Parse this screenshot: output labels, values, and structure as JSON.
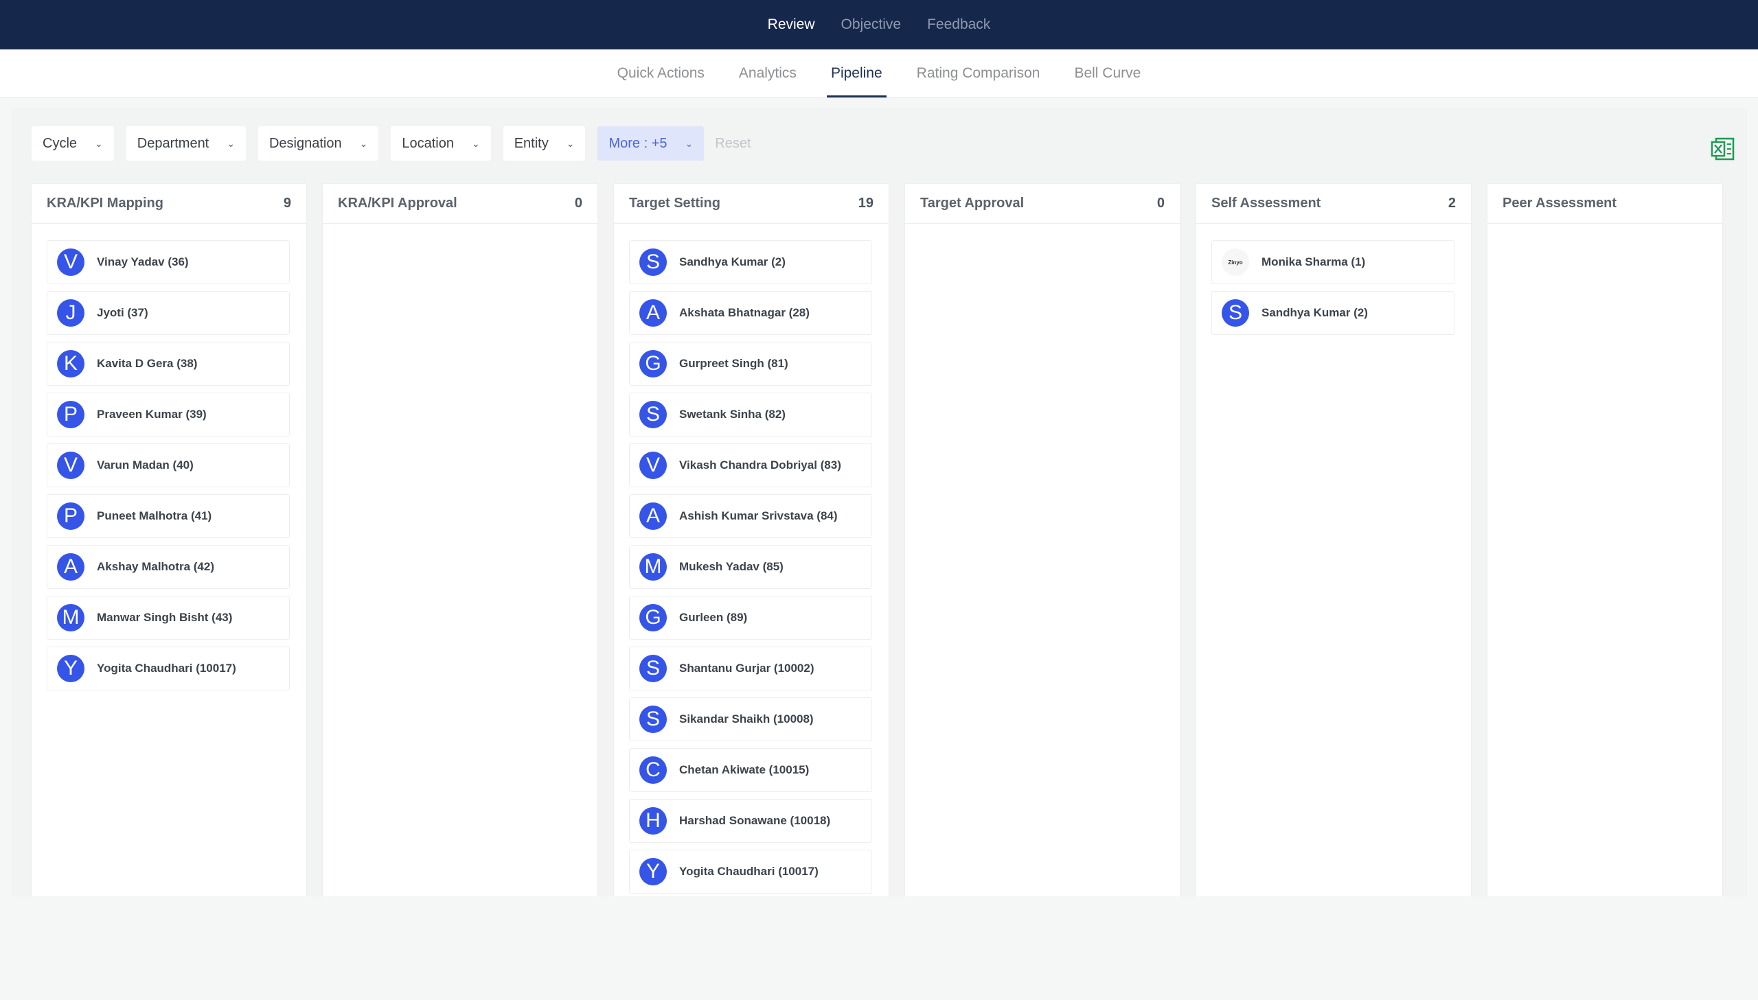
{
  "top_nav": {
    "tabs": [
      {
        "label": "Review",
        "active": true
      },
      {
        "label": "Objective",
        "active": false
      },
      {
        "label": "Feedback",
        "active": false
      }
    ]
  },
  "sub_nav": {
    "tabs": [
      {
        "label": "Quick Actions",
        "active": false
      },
      {
        "label": "Analytics",
        "active": false
      },
      {
        "label": "Pipeline",
        "active": true
      },
      {
        "label": "Rating Comparison",
        "active": false
      },
      {
        "label": "Bell Curve",
        "active": false
      }
    ]
  },
  "filters": {
    "items": [
      "Cycle",
      "Department",
      "Designation",
      "Location",
      "Entity"
    ],
    "more_label": "More : +5",
    "reset_label": "Reset",
    "export_icon": "excel-icon"
  },
  "colors": {
    "avatar": "#3554e8",
    "top_nav_bg": "#15274a",
    "more_bg": "#dfe5fb",
    "excel": "#1d9b52"
  },
  "columns": [
    {
      "title": "KRA/KPI Mapping",
      "count": "9",
      "cards": [
        {
          "initial": "V",
          "name": "Vinay Yadav (36)"
        },
        {
          "initial": "J",
          "name": "Jyoti (37)"
        },
        {
          "initial": "K",
          "name": "Kavita D Gera (38)"
        },
        {
          "initial": "P",
          "name": "Praveen Kumar (39)"
        },
        {
          "initial": "V",
          "name": "Varun Madan (40)"
        },
        {
          "initial": "P",
          "name": "Puneet Malhotra (41)"
        },
        {
          "initial": "A",
          "name": "Akshay Malhotra (42)"
        },
        {
          "initial": "M",
          "name": "Manwar Singh Bisht (43)"
        },
        {
          "initial": "Y",
          "name": "Yogita Chaudhari (10017)"
        }
      ]
    },
    {
      "title": "KRA/KPI Approval",
      "count": "0",
      "cards": []
    },
    {
      "title": "Target Setting",
      "count": "19",
      "cards": [
        {
          "initial": "S",
          "name": "Sandhya Kumar (2)"
        },
        {
          "initial": "A",
          "name": "Akshata Bhatnagar (28)"
        },
        {
          "initial": "G",
          "name": "Gurpreet Singh (81)"
        },
        {
          "initial": "S",
          "name": "Swetank Sinha (82)"
        },
        {
          "initial": "V",
          "name": "Vikash Chandra Dobriyal (83)"
        },
        {
          "initial": "A",
          "name": "Ashish Kumar Srivstava (84)"
        },
        {
          "initial": "M",
          "name": "Mukesh Yadav (85)"
        },
        {
          "initial": "G",
          "name": "Gurleen (89)"
        },
        {
          "initial": "S",
          "name": "Shantanu Gurjar (10002)"
        },
        {
          "initial": "S",
          "name": "Sikandar Shaikh (10008)"
        },
        {
          "initial": "C",
          "name": "Chetan Akiwate (10015)"
        },
        {
          "initial": "H",
          "name": "Harshad Sonawane (10018)"
        },
        {
          "initial": "Y",
          "name": "Yogita Chaudhari (10017)"
        }
      ]
    },
    {
      "title": "Target Approval",
      "count": "0",
      "cards": []
    },
    {
      "title": "Self Assessment",
      "count": "2",
      "cards": [
        {
          "initial": "Zinyo",
          "logo": true,
          "name": "Monika Sharma (1)"
        },
        {
          "initial": "S",
          "name": "Sandhya Kumar (2)"
        }
      ]
    },
    {
      "title": "Peer Assessment",
      "count": "",
      "cards": []
    }
  ]
}
